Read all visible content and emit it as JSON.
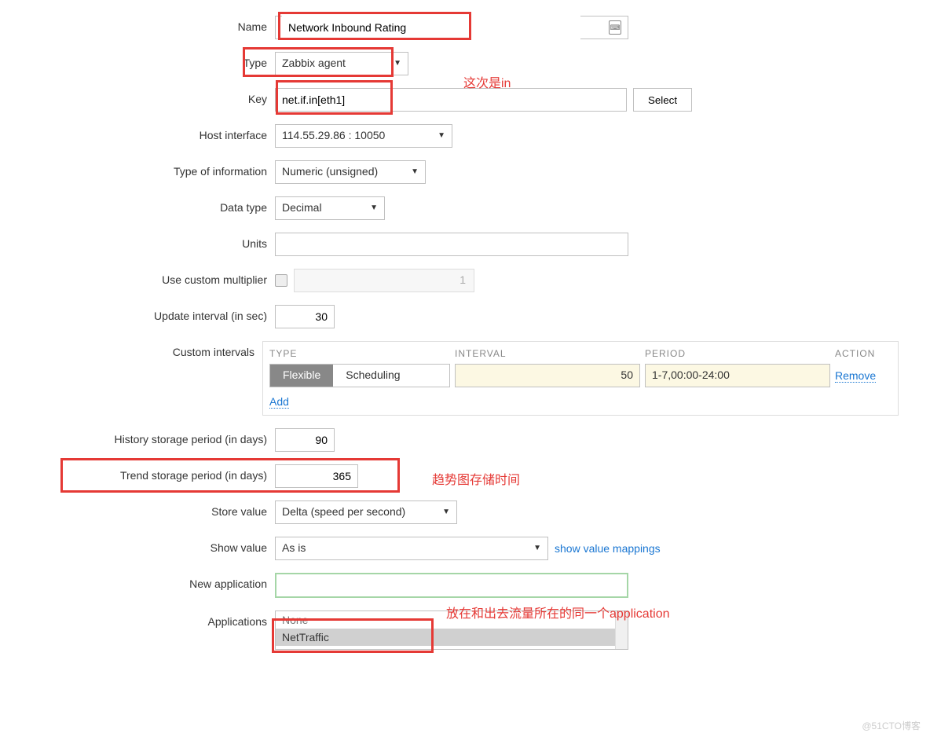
{
  "labels": {
    "name": "Name",
    "type": "Type",
    "key": "Key",
    "host_interface": "Host interface",
    "type_info": "Type of information",
    "data_type": "Data type",
    "units": "Units",
    "use_multiplier": "Use custom multiplier",
    "update_interval": "Update interval (in sec)",
    "custom_intervals": "Custom intervals",
    "history": "History storage period (in days)",
    "trend": "Trend storage period (in days)",
    "store_value": "Store value",
    "show_value": "Show value",
    "new_app": "New application",
    "applications": "Applications"
  },
  "values": {
    "name": "Network Inbound Rating",
    "type": "Zabbix agent",
    "key": "net.if.in[eth1]",
    "host_interface": "114.55.29.86 : 10050",
    "type_info": "Numeric (unsigned)",
    "data_type": "Decimal",
    "units": "",
    "multiplier_disabled": "1",
    "update_interval": "30",
    "history": "90",
    "trend": "365",
    "store_value": "Delta (speed per second)",
    "show_value": "As is",
    "app_none": "None",
    "app_selected": "NetTraffic"
  },
  "buttons": {
    "select": "Select"
  },
  "custom_intervals": {
    "headers": {
      "type": "TYPE",
      "interval": "INTERVAL",
      "period": "PERIOD",
      "action": "ACTION"
    },
    "seg": {
      "flexible": "Flexible",
      "scheduling": "Scheduling"
    },
    "interval_val": "50",
    "period_val": "1-7,00:00-24:00",
    "remove": "Remove",
    "add": "Add"
  },
  "links": {
    "show_mappings": "show value mappings"
  },
  "annotations": {
    "key_note": "这次是in",
    "trend_note": "趋势图存储时间",
    "app_note": "放在和出去流量所在的同一个application"
  },
  "watermark": "@51CTO博客"
}
